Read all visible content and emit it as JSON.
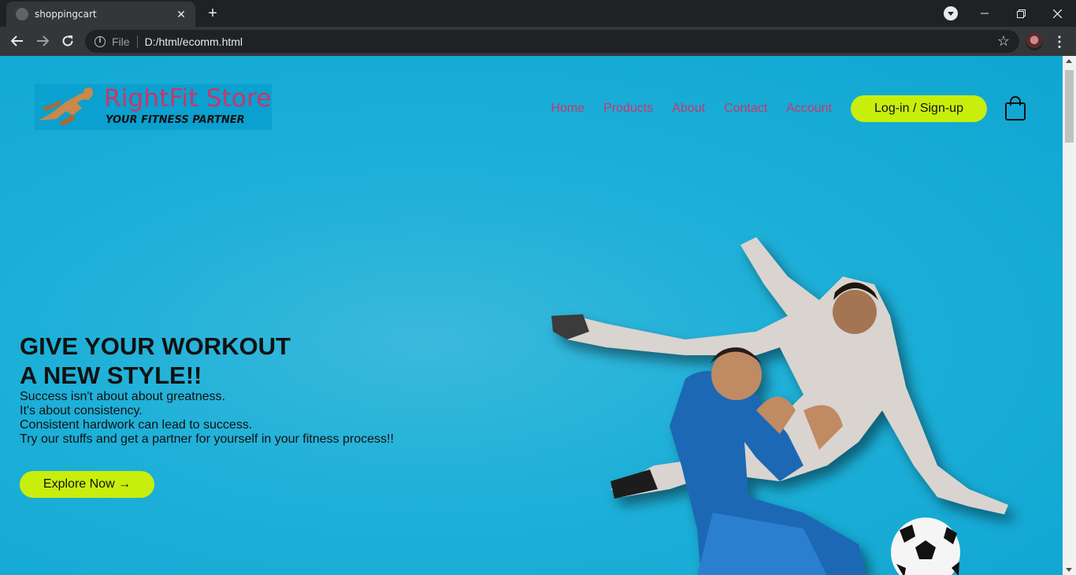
{
  "browser": {
    "tab_title": "shoppingcart",
    "tab_close": "✕",
    "new_tab": "+",
    "file_label": "File",
    "url": "D:/html/ecomm.html",
    "star": "☆",
    "menu": "⋮"
  },
  "site": {
    "logo_name": "RightFit Store",
    "logo_tagline": "YOUR FITNESS PARTNER",
    "nav": [
      "Home",
      "Products",
      "About",
      "Contact",
      "Account"
    ],
    "login_label": "Log-in / Sign-up",
    "hero_title_line1": "GIVE YOUR WORKOUT",
    "hero_title_line2": "A NEW STYLE!!",
    "hero_lines": [
      "Success isn't about about greatness.",
      "It's about consistency.",
      "Consistent hardwork can lead to success.",
      "Try our stuffs and get a partner for yourself in your fitness process!!"
    ],
    "explore_label": "Explore Now →"
  },
  "colors": {
    "background": "#1eb0d8",
    "nav_link": "#c9366b",
    "button": "#c8ee0c"
  }
}
